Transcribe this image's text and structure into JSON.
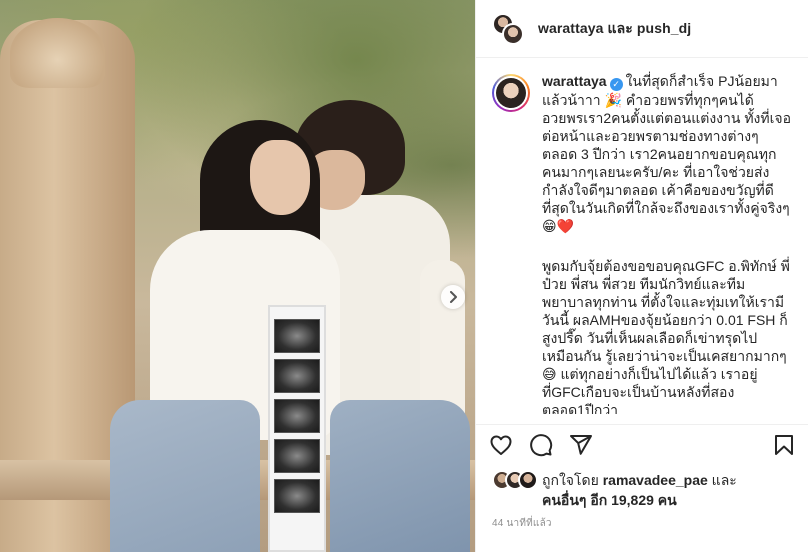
{
  "header": {
    "title": "warattaya และ push_dj"
  },
  "caption": {
    "username": "warattaya",
    "text_p1": "ในที่สุดก็สำเร็จ PJน้อยมาแล้วน้าาา 🎉 คำอวยพรที่ทุกๆคนได้อวยพรเรา2คนตั้งแต่ตอนแต่งงาน ทั้งที่เจอต่อหน้าและอวยพรตามช่องทางต่างๆตลอด 3 ปีกว่า เรา2คนอยากขอบคุณทุกคนมากๆเลยนะครับ/คะ ที่เอาใจช่วยส่งกำลังใจดีๆมาตลอด เค้าคือของขวัญที่ดีที่สุดในวันเกิดที่ใกล้จะถึงของเราทั้งคู่จริงๆ 😁❤️",
    "text_p2": "พูดมกับจุ้ยต้องขอขอบคุณGFC อ.พิทักษ์ พี่ป๋วย พี่สน พี่สวย ทีมนักวิทย์และทีมพยาบาลทุกท่าน ที่ตั้งใจและทุ่มเทให้เรามีวันนี้ ผลAMHของจุ้ยน้อยกว่า 0.01 FSH ก็สูงปรี๊ด วันที่เห็นผลเลือดก็เข่าทรุดไปเหมือนกัน รู้เลยว่าน่าจะเป็นเคสยากมากๆ 😅 แต่ทุกอย่างก็เป็นไปได้แล้ว เราอยู่ที่GFCเกือบจะเป็นบ้านหลังที่สองตลอด1ปีกว่า"
  },
  "likes": {
    "prefix": "ถูกใจโดย ",
    "user": "ramavadee_pae",
    "joiner": " และ",
    "others": "คนอื่นๆ อีก 19,829 คน"
  },
  "timestamp": "44 นาทีที่แล้ว",
  "icons": {
    "like": "heart-icon",
    "comment": "comment-icon",
    "share": "share-icon",
    "save": "bookmark-icon",
    "next": "chevron-right-icon",
    "verified": "verified-badge-icon"
  },
  "colors": {
    "verified": "#3897f0",
    "text": "#262626",
    "muted": "#8e8e8e"
  }
}
